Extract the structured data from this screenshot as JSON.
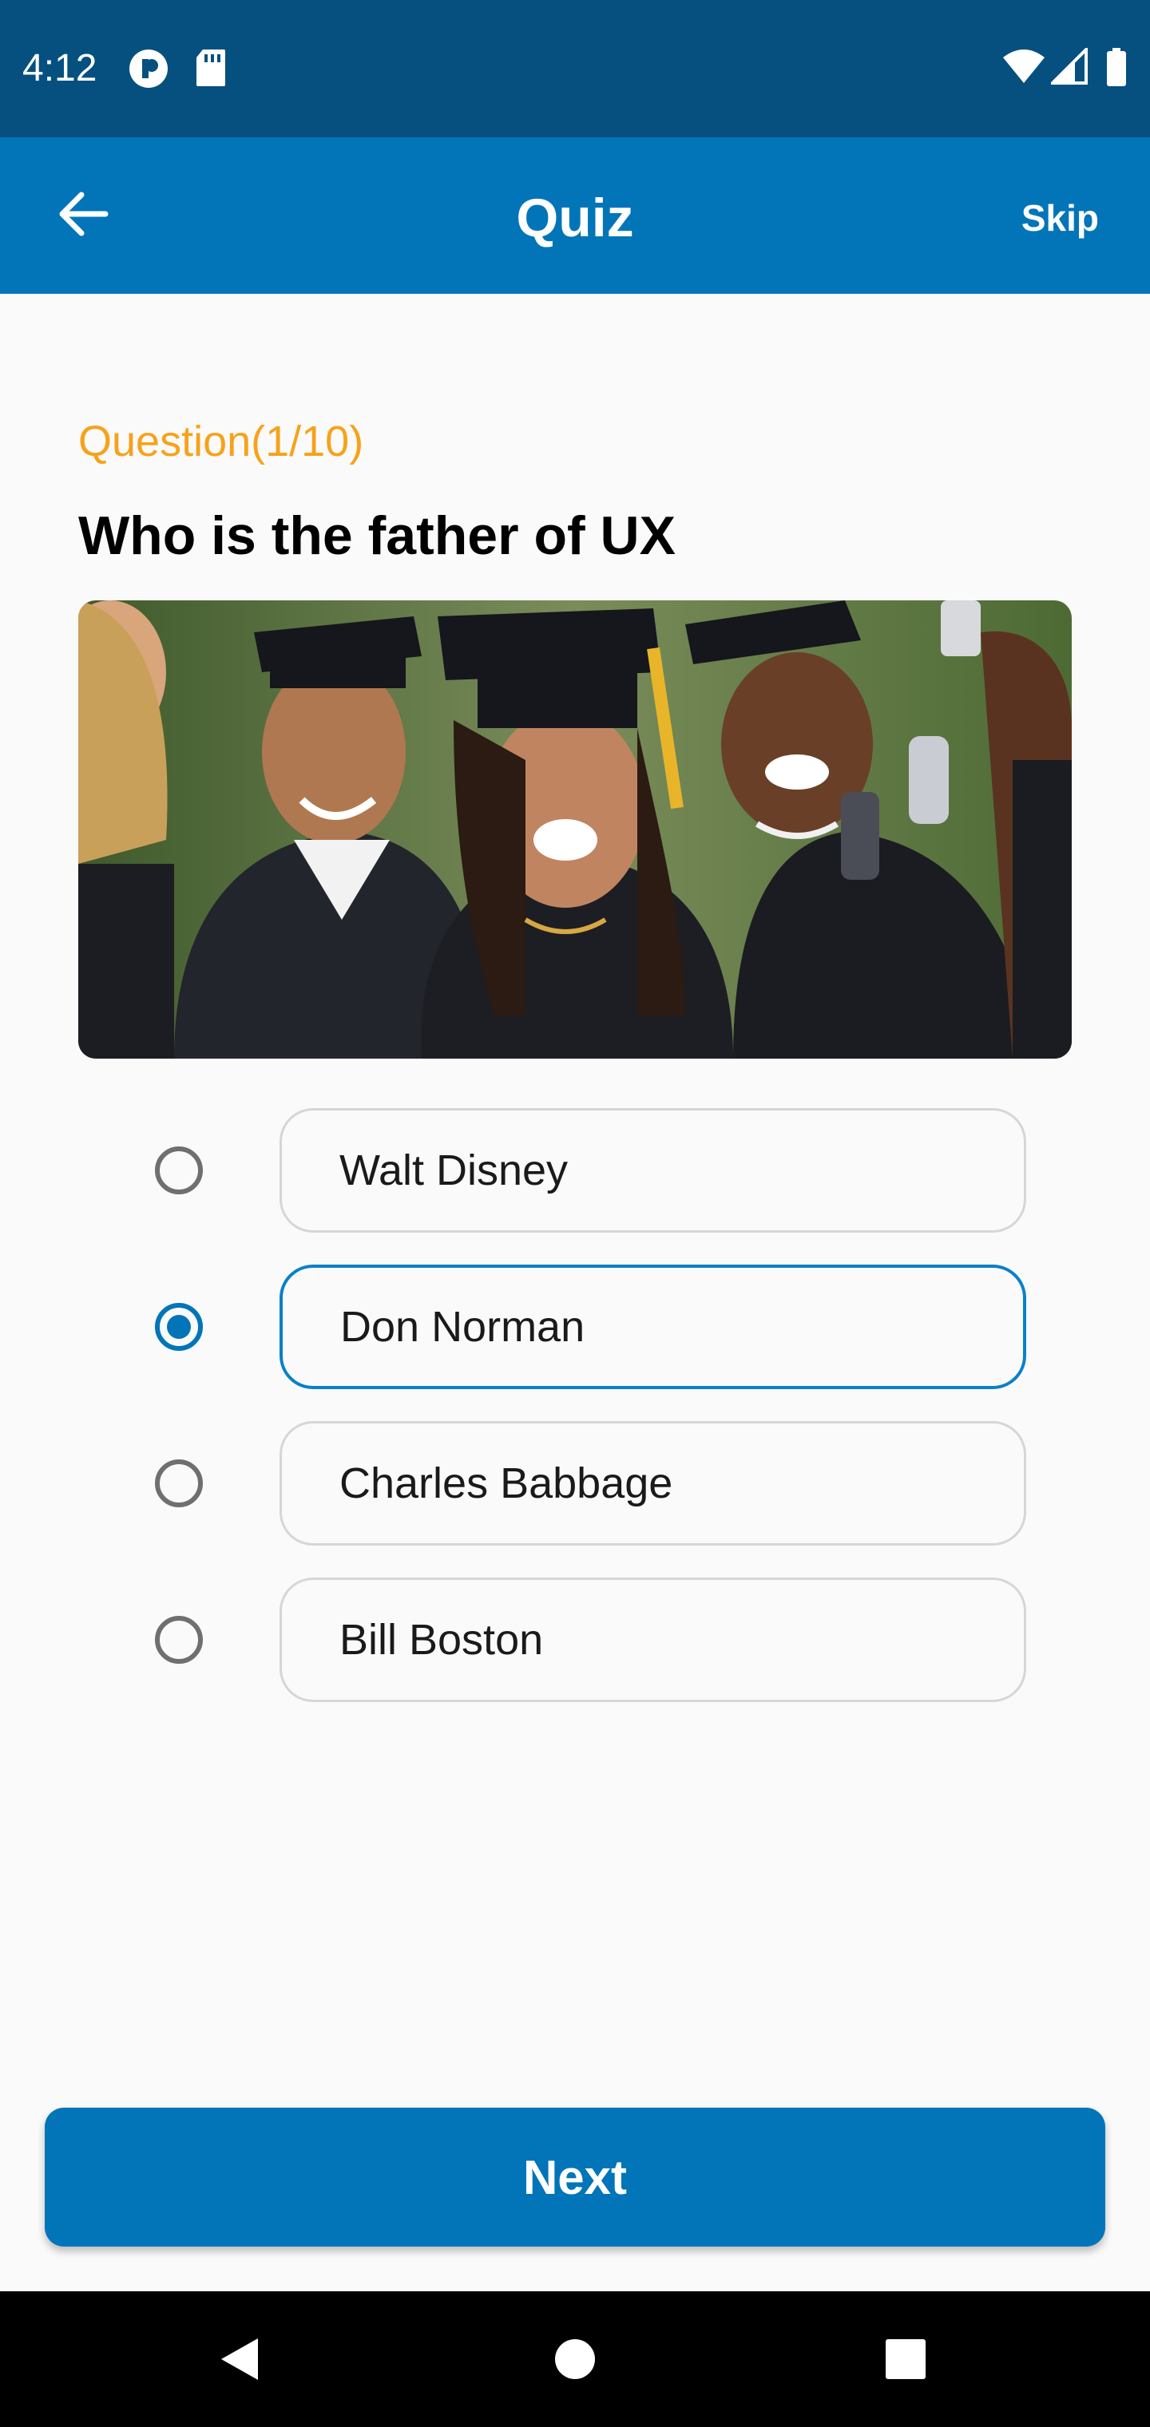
{
  "status_bar": {
    "time": "4:12",
    "icons": [
      "vpn-icon",
      "sd-card-icon",
      "wifi-icon",
      "signal-icon",
      "battery-icon"
    ]
  },
  "app_bar": {
    "title": "Quiz",
    "skip_label": "Skip",
    "back_icon": "arrow-left-icon"
  },
  "quiz": {
    "question_count": "Question(1/10)",
    "question_text": "Who is the father of UX",
    "image_icon": "graduates-photo",
    "options": [
      {
        "label": "Walt Disney",
        "selected": false
      },
      {
        "label": "Don Norman",
        "selected": true
      },
      {
        "label": "Charles Babbage",
        "selected": false
      },
      {
        "label": "Bill Boston",
        "selected": false
      }
    ]
  },
  "next_button": {
    "label": "Next"
  },
  "nav_bar": {
    "icons": [
      "back-triangle-icon",
      "home-circle-icon",
      "recents-square-icon"
    ]
  },
  "colors": {
    "status_bar": "#05507f",
    "app_bar": "#0275b9",
    "accent_orange": "#f7a21b",
    "selected_blue": "#0275b9"
  }
}
